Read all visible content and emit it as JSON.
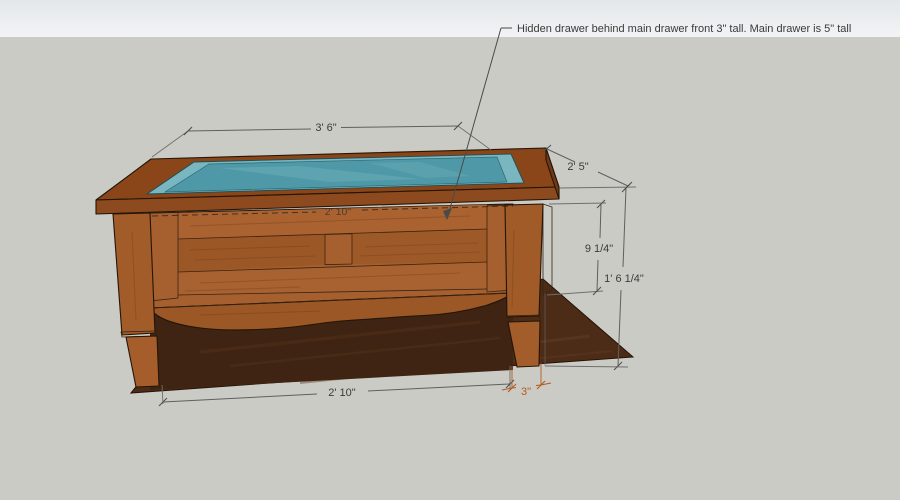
{
  "viewport": {
    "app_context": "3d-model-viewport",
    "background": {
      "sky_top": "#e3e7e9",
      "sky_bottom": "#f1f2f4",
      "ground": "#cbcbc6"
    },
    "model": {
      "name": "coffee-table-with-glass-display-top",
      "wood_color": "#a3602c",
      "wood_dark_color": "#8d4a1f",
      "glass_color": "#4f98a7",
      "glass_rim_color": "#7ab6bf",
      "shadow_color": "#4c2c17"
    },
    "callout": {
      "text": "Hidden drawer behind main drawer front 3\" tall. Main drawer is 5\" tall"
    },
    "dimensions": {
      "line_color": "#5f5f5f",
      "text_color": "#3b3b3b",
      "highlight_color": "#b4591d",
      "top_back_width": "3' 6\"",
      "top_depth": "2' 5\"",
      "apron_height": "9 1/4\"",
      "overall_height": "1' 6 1/4\"",
      "between_legs_width": "2' 10\"",
      "drawer_opening_width": "2' 10\"",
      "foot_width": "3\""
    }
  }
}
